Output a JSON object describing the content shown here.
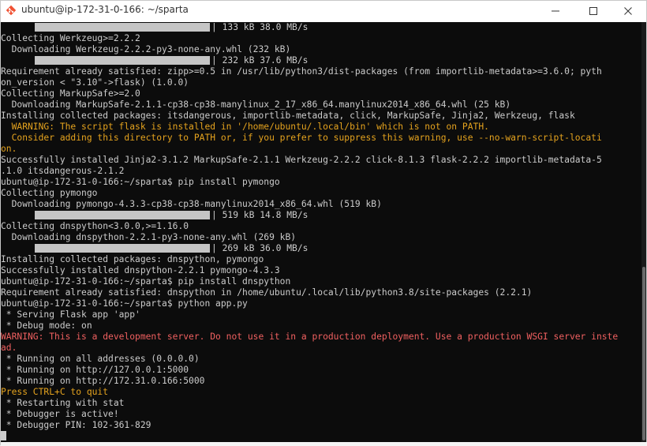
{
  "window": {
    "title": "ubuntu@ip-172-31-0-166: ~/sparta",
    "controls": [
      "minimize-icon",
      "maximize-icon",
      "close-icon"
    ]
  },
  "terminal": {
    "background": "#0c0c0c",
    "colors": {
      "default": "#cccccc",
      "warning": "#e5a31e",
      "error": "#f06060",
      "progress": "#c5c5c5"
    },
    "lines": [
      {
        "text": "| 133 kB 38.0 MB/s",
        "bar": true,
        "type": "normal"
      },
      {
        "text": "Collecting Werkzeug>=2.2.2",
        "type": "normal"
      },
      {
        "text": "  Downloading Werkzeug-2.2.2-py3-none-any.whl (232 kB)",
        "type": "normal"
      },
      {
        "text": "| 232 kB 37.6 MB/s",
        "bar": true,
        "type": "normal"
      },
      {
        "text": "Requirement already satisfied: zipp>=0.5 in /usr/lib/python3/dist-packages (from importlib-metadata>=3.6.0; pyth",
        "type": "normal"
      },
      {
        "text": "on_version < \"3.10\"->flask) (1.0.0)",
        "type": "normal"
      },
      {
        "text": "Collecting MarkupSafe>=2.0",
        "type": "normal"
      },
      {
        "text": "  Downloading MarkupSafe-2.1.1-cp38-cp38-manylinux_2_17_x86_64.manylinux2014_x86_64.whl (25 kB)",
        "type": "normal"
      },
      {
        "text": "Installing collected packages: itsdangerous, importlib-metadata, click, MarkupSafe, Jinja2, Werkzeug, flask",
        "type": "normal"
      },
      {
        "text": "  WARNING: The script flask is installed in '/home/ubuntu/.local/bin' which is not on PATH.",
        "type": "warn"
      },
      {
        "text": "  Consider adding this directory to PATH or, if you prefer to suppress this warning, use --no-warn-script-locati",
        "type": "warn"
      },
      {
        "text": "on.",
        "type": "warn"
      },
      {
        "text": "Successfully installed Jinja2-3.1.2 MarkupSafe-2.1.1 Werkzeug-2.2.2 click-8.1.3 flask-2.2.2 importlib-metadata-5",
        "type": "normal"
      },
      {
        "text": ".1.0 itsdangerous-2.1.2",
        "type": "normal"
      },
      {
        "text": "ubuntu@ip-172-31-0-166:~/sparta$ pip install pymongo",
        "type": "normal"
      },
      {
        "text": "Collecting pymongo",
        "type": "normal"
      },
      {
        "text": "  Downloading pymongo-4.3.3-cp38-cp38-manylinux2014_x86_64.whl (519 kB)",
        "type": "normal"
      },
      {
        "text": "| 519 kB 14.8 MB/s",
        "bar": true,
        "type": "normal"
      },
      {
        "text": "Collecting dnspython<3.0.0,>=1.16.0",
        "type": "normal"
      },
      {
        "text": "  Downloading dnspython-2.2.1-py3-none-any.whl (269 kB)",
        "type": "normal"
      },
      {
        "text": "| 269 kB 36.0 MB/s",
        "bar": true,
        "type": "normal"
      },
      {
        "text": "Installing collected packages: dnspython, pymongo",
        "type": "normal"
      },
      {
        "text": "Successfully installed dnspython-2.2.1 pymongo-4.3.3",
        "type": "normal"
      },
      {
        "text": "ubuntu@ip-172-31-0-166:~/sparta$ pip install dnspython",
        "type": "normal"
      },
      {
        "text": "Requirement already satisfied: dnspython in /home/ubuntu/.local/lib/python3.8/site-packages (2.2.1)",
        "type": "normal"
      },
      {
        "text": "ubuntu@ip-172-31-0-166:~/sparta$ python app.py",
        "type": "normal"
      },
      {
        "text": " * Serving Flask app 'app'",
        "type": "normal"
      },
      {
        "text": " * Debug mode: on",
        "type": "normal"
      },
      {
        "text": "WARNING: This is a development server. Do not use it in a production deployment. Use a production WSGI server inste",
        "type": "err"
      },
      {
        "text": "ad.",
        "type": "err"
      },
      {
        "text": " * Running on all addresses (0.0.0.0)",
        "type": "normal"
      },
      {
        "text": " * Running on http://127.0.0.1:5000",
        "type": "normal"
      },
      {
        "text": " * Running on http://172.31.0.166:5000",
        "type": "normal"
      },
      {
        "text": "Press CTRL+C to quit",
        "type": "warn"
      },
      {
        "text": " * Restarting with stat",
        "type": "normal"
      },
      {
        "text": " * Debugger is active!",
        "type": "normal"
      },
      {
        "text": " * Debugger PIN: 102-361-829",
        "type": "normal"
      },
      {
        "text": "",
        "cursor": true,
        "type": "normal"
      }
    ]
  }
}
